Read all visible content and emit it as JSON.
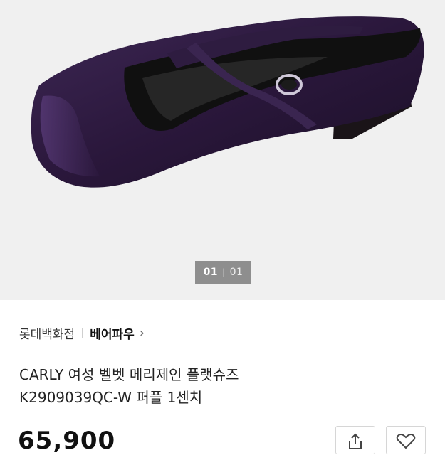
{
  "gallery": {
    "current_page": "01",
    "separator": "|",
    "total_pages": "01",
    "image_description_icon": "velvet-flat-shoe-photo"
  },
  "store": {
    "name": "롯데백화점",
    "brand": "베어파우",
    "brand_chevron": "›"
  },
  "product": {
    "title": "CARLY 여성 벨벳 메리제인 플랫슈즈 K2909039QC-W 퍼플 1센치",
    "price": "65,900"
  },
  "actions": {
    "share_icon": "share-icon",
    "wish_icon": "heart-outline-icon"
  },
  "colors": {
    "hero_bg": "#f0f0f0",
    "shoe": "#2c1a3e"
  }
}
